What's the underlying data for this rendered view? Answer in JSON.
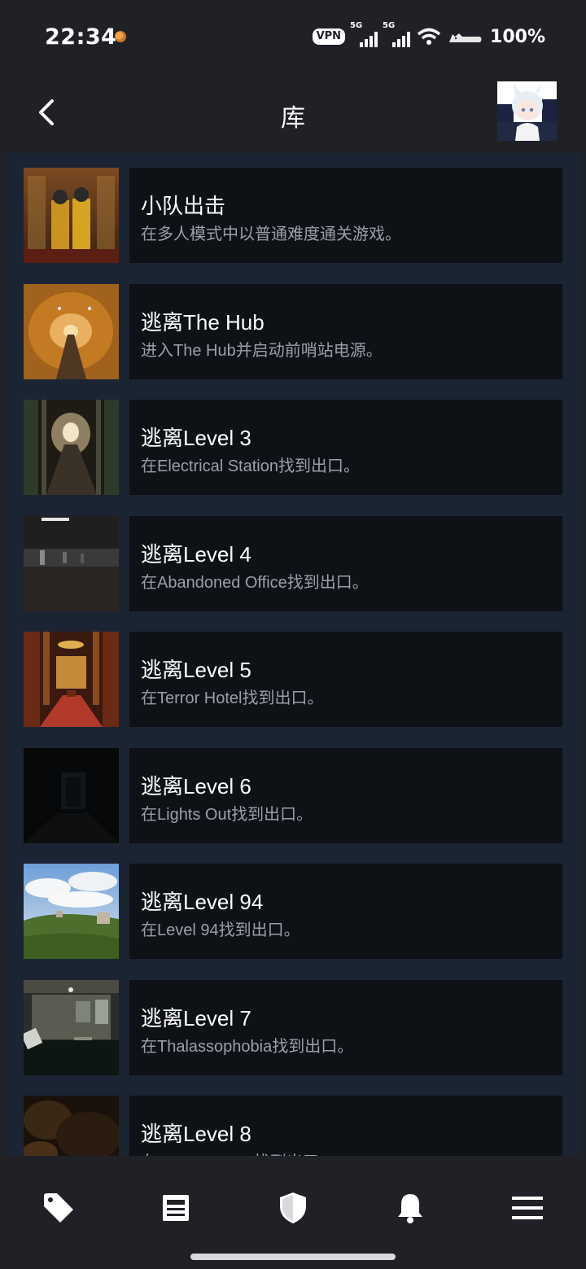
{
  "status_bar": {
    "time": "22:34",
    "vpn_label": "VPN",
    "network1": "5G",
    "network2": "5G",
    "battery": "100%"
  },
  "header": {
    "title": "库"
  },
  "achievements": [
    {
      "title": "小队出击",
      "description": "在多人模式中以普通难度通关游戏。"
    },
    {
      "title": "逃离The Hub",
      "description": "进入The Hub并启动前哨站电源。"
    },
    {
      "title": "逃离Level 3",
      "description": "在Electrical Station找到出口。"
    },
    {
      "title": "逃离Level 4",
      "description": "在Abandoned Office找到出口。"
    },
    {
      "title": "逃离Level 5",
      "description": "在Terror Hotel找到出口。"
    },
    {
      "title": "逃离Level 6",
      "description": "在Lights Out找到出口。"
    },
    {
      "title": "逃离Level 94",
      "description": "在Level 94找到出口。"
    },
    {
      "title": "逃离Level 7",
      "description": "在Thalassophobia找到出口。"
    },
    {
      "title": "逃离Level 8",
      "description": "在Cave System找到出口。"
    }
  ],
  "nav": [
    "tag-icon",
    "news-icon",
    "shield-icon",
    "bell-icon",
    "menu-icon"
  ]
}
